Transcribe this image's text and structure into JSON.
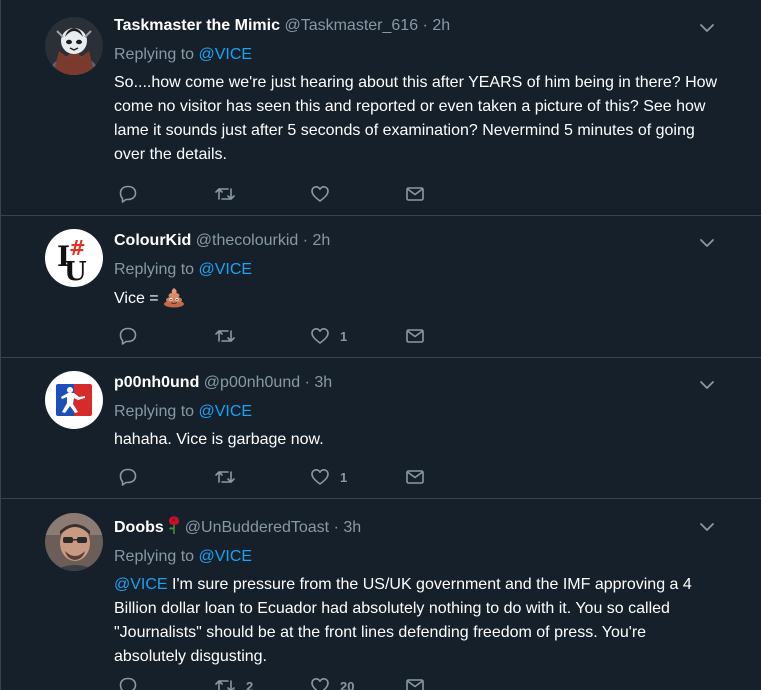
{
  "colors": {
    "background": "#15202b",
    "border": "#38444d",
    "muted": "#8899a6",
    "mention": "#1da1f2",
    "text": "#ffffff"
  },
  "tweets": [
    {
      "display_name": "Taskmaster the Mimic",
      "handle": "@Taskmaster_616",
      "time": "· 2h",
      "replying_prefix": "Replying to",
      "replying_to": "@VICE",
      "text": "So....how come we're just hearing about this after YEARS of him being in there? How come no visitor has seen this and reported or even taken a picture of this? See how lame it sounds just after 5 seconds of examination? Nevermind 5 minutes of going over the details.",
      "likes": ""
    },
    {
      "display_name": "ColourKid",
      "handle": "@thecolourkid",
      "time": "· 2h",
      "replying_prefix": "Replying to",
      "replying_to": "@VICE",
      "text": "Vice =",
      "emoji": "pile-of-poo-icon",
      "likes": "1"
    },
    {
      "display_name": "p00nh0und",
      "handle": "@p00nh0und",
      "time": "· 3h",
      "replying_prefix": "Replying to",
      "replying_to": "@VICE",
      "text": "hahaha. Vice is garbage now.",
      "likes": "1"
    },
    {
      "display_name": "Doobs",
      "name_emoji": "rose-icon",
      "handle": "@UnBudderedToast",
      "time": "· 3h",
      "replying_prefix": "Replying to",
      "replying_to": "@VICE",
      "text_mention": "@VICE",
      "text": " I'm sure pressure from the US/UK government and the IMF approving a 4 Billion dollar loan to Ecuador had absolutely nothing to do with it. You so called \"Journalists\" should be at the front lines defending freedom of press. You're absolutely disgusting.",
      "retweets": "2",
      "likes": "20"
    }
  ]
}
